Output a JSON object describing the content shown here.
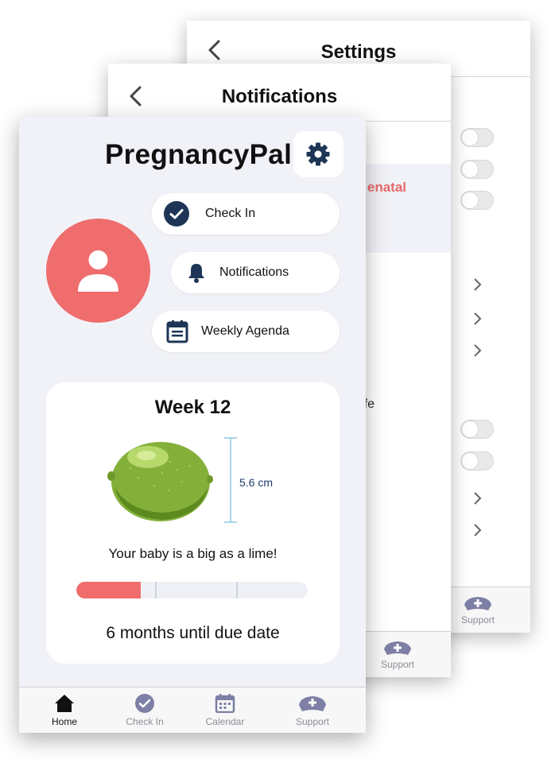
{
  "settings": {
    "title": "Settings",
    "nav_support": "Support"
  },
  "notifications": {
    "title": "Notifications",
    "partial_prenatal": "enatal",
    "partial_fe": "fe",
    "nav_support": "Support"
  },
  "home": {
    "app_title": "PregnancyPal",
    "buttons": {
      "check_in": "Check In",
      "notifications": "Notifications",
      "weekly_agenda": "Weekly Agenda"
    },
    "week_card": {
      "week_label": "Week 12",
      "size": "5.6 cm",
      "message": "Your baby is a big as a lime!",
      "progress": 0.28,
      "due": "6 months until due date"
    },
    "nav": {
      "home": "Home",
      "check_in": "Check In",
      "calendar": "Calendar",
      "support": "Support"
    }
  },
  "colors": {
    "accent": "#ef6d6d",
    "navy": "#1e3556",
    "nav_inactive": "#8c8c98",
    "background": "#f1f2f7"
  },
  "icons": [
    "back-chevron-icon",
    "gear-icon",
    "user-icon",
    "check-circle-icon",
    "bell-icon",
    "calendar-icon",
    "lime-illustration",
    "home-icon",
    "support-icon"
  ]
}
